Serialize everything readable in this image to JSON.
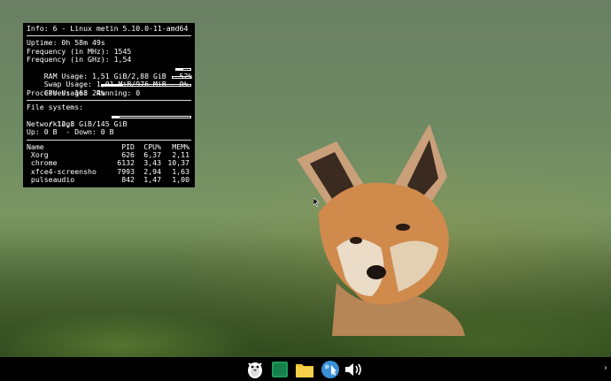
{
  "conky": {
    "info": "Info: 6 - Linux metin 5.10.0-11-amd64",
    "uptime": "Uptime: 0h 58m 49s",
    "freq_mhz": "Frequency (in MHz): 1545",
    "freq_ghz": "Frequency (in GHz): 1,54",
    "ram": "RAM Usage: 1,51 GiB/2,88 GiB - 52%",
    "ram_percent": 52,
    "swap": "Swap Usage: 1,01 MiB/976 MiB - 0%",
    "swap_percent": 0,
    "cpu": "CPU Usage: 24%",
    "cpu_percent": 24,
    "processes": "Processes: 168  Running: 0",
    "fs_heading": "File systems:",
    "fs_root": " / 12,8 GiB/145 GiB",
    "fs_percent": 9,
    "net_heading": "Networking:",
    "net": "Up: 0 B  - Down: 0 B",
    "proc_headers": {
      "name": "Name",
      "pid": "PID",
      "cpu": "CPU%",
      "mem": "MEM%"
    },
    "procs": [
      {
        "name": " Xorg",
        "pid": "626",
        "cpu": "6,37",
        "mem": "2,11"
      },
      {
        "name": " chrome",
        "pid": "6132",
        "cpu": "3,43",
        "mem": "10,37"
      },
      {
        "name": " xfce4-screensho",
        "pid": "7993",
        "cpu": "2,94",
        "mem": "1,63"
      },
      {
        "name": " pulseaudio",
        "pid": "842",
        "cpu": "1,47",
        "mem": "1,00"
      }
    ]
  },
  "taskbar": {
    "icons": [
      "penguin-menu-icon",
      "terminal-icon",
      "file-manager-icon",
      "web-browser-icon",
      "volume-icon"
    ],
    "chevron": "›"
  },
  "colors": {
    "panel_bg": "#000000",
    "text": "#ffffff"
  }
}
